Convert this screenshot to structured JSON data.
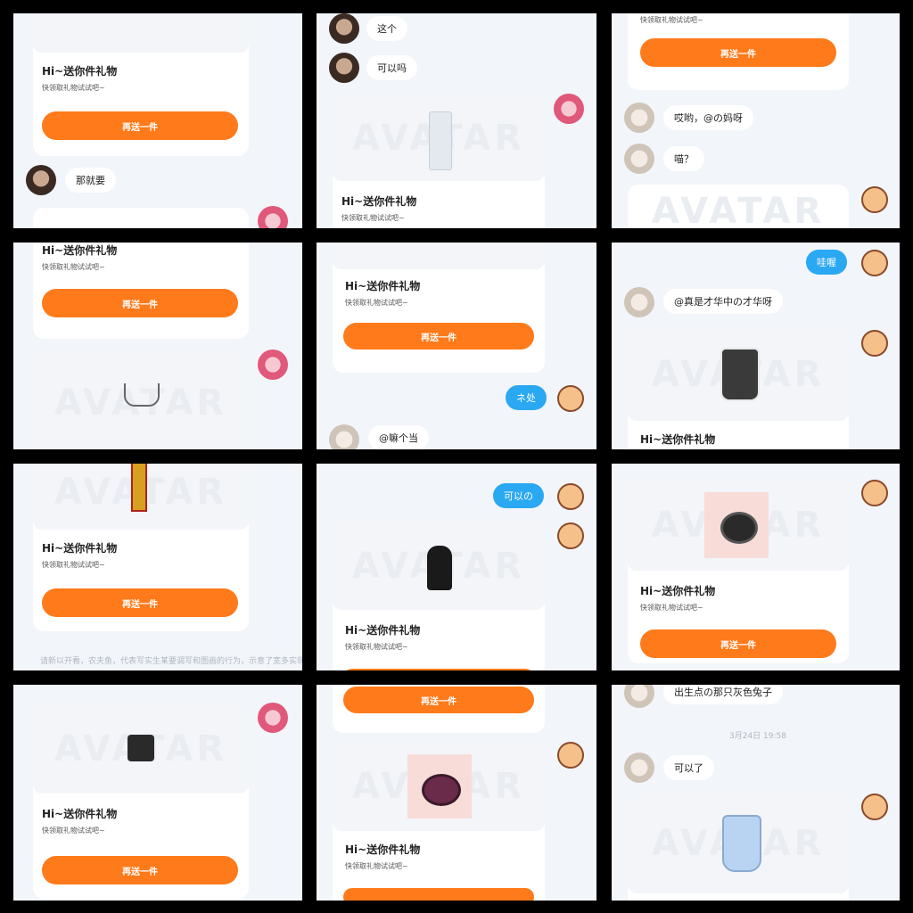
{
  "gift": {
    "title": "Hi~送你件礼物",
    "subtitle": "快领取礼物试试吧~",
    "button": "再送一件",
    "watermark": "AVATAR"
  },
  "messages": {
    "p1_reply": "那就要",
    "p2_this": "这个",
    "p2_ok": "可以吗",
    "p3_oh": "哎哟，@の妈呀",
    "p3_meow": "喵？",
    "p6_blue": "哇喔",
    "p6_talent": "@真是才华中の才华呀",
    "p5_blue": "ネ处",
    "p5_dark": "@嘛个当",
    "p8_blue": "可以の",
    "p12_rabbit": "出生点の那只灰色兔子",
    "p12_time": "3月24日 19:58",
    "p12_ok": "可以了",
    "p7_caption": "请新以开看，农夫鱼，代表写实生某要调写和图画的行为，示意了宽多实现多行为"
  }
}
